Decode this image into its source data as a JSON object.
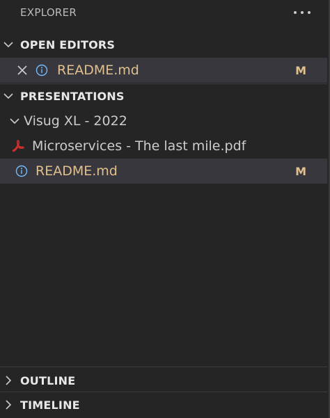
{
  "explorer": {
    "title": "EXPLORER"
  },
  "open_editors": {
    "header": "OPEN EDITORS",
    "items": [
      {
        "name": "README.md",
        "status": "M"
      }
    ]
  },
  "presentations": {
    "header": "PRESENTATIONS",
    "folder": "Visug XL - 2022",
    "file_pdf": "Microservices - The last mile.pdf",
    "file_readme": "README.md",
    "file_readme_status": "M"
  },
  "outline": {
    "header": "OUTLINE"
  },
  "timeline": {
    "header": "TIMELINE"
  },
  "colors": {
    "background": "#252526",
    "selected_row": "#37373d",
    "modified": "#e2c08d",
    "info_icon": "#75beff",
    "pdf_icon": "#d0312d"
  },
  "icons": [
    "more-icon",
    "chevron-down-icon",
    "chevron-right-icon",
    "close-icon",
    "info-icon",
    "pdf-icon"
  ]
}
